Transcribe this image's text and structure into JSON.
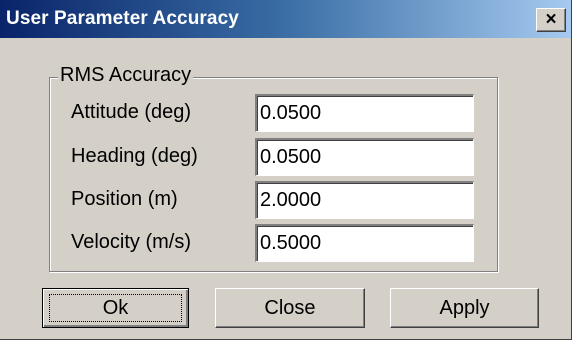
{
  "window": {
    "title": "User Parameter Accuracy",
    "close_glyph": "×"
  },
  "group": {
    "legend": "RMS Accuracy"
  },
  "fields": [
    {
      "label": "Attitude (deg)",
      "value": "0.0500"
    },
    {
      "label": "Heading (deg)",
      "value": "0.0500"
    },
    {
      "label": "Position (m)",
      "value": "2.0000"
    },
    {
      "label": "Velocity (m/s)",
      "value": "0.5000"
    }
  ],
  "buttons": {
    "ok": "Ok",
    "close": "Close",
    "apply": "Apply"
  }
}
